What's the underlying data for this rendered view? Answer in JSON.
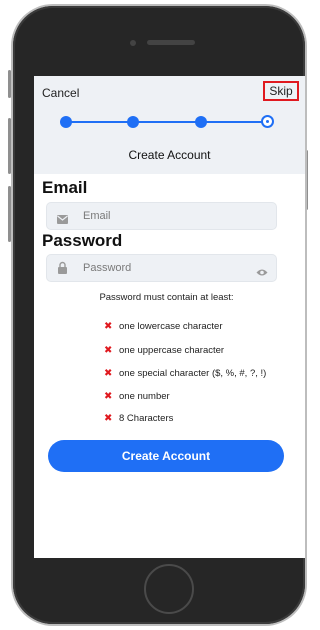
{
  "header": {
    "cancel_label": "Cancel",
    "skip_label": "Skip",
    "title": "Create Account",
    "steps_total": 4,
    "active_step": 4
  },
  "email": {
    "label": "Email",
    "placeholder": "Email",
    "icon": "envelope-icon"
  },
  "password": {
    "label": "Password",
    "placeholder": "Password",
    "icon": "lock-icon",
    "toggle_icon": "eye-icon"
  },
  "requirements": {
    "heading": "Password must contain at least:",
    "items": [
      "one lowercase character",
      "one uppercase character",
      "one special character ($, %, #, ?, !)",
      "one number",
      "8 Characters"
    ],
    "status_icon": "x-mark-icon"
  },
  "cta_label": "Create Account",
  "colors": {
    "accent": "#1f6ff5",
    "error": "#e0191f",
    "header_bg": "#eef1f5",
    "phone": "#262626"
  }
}
